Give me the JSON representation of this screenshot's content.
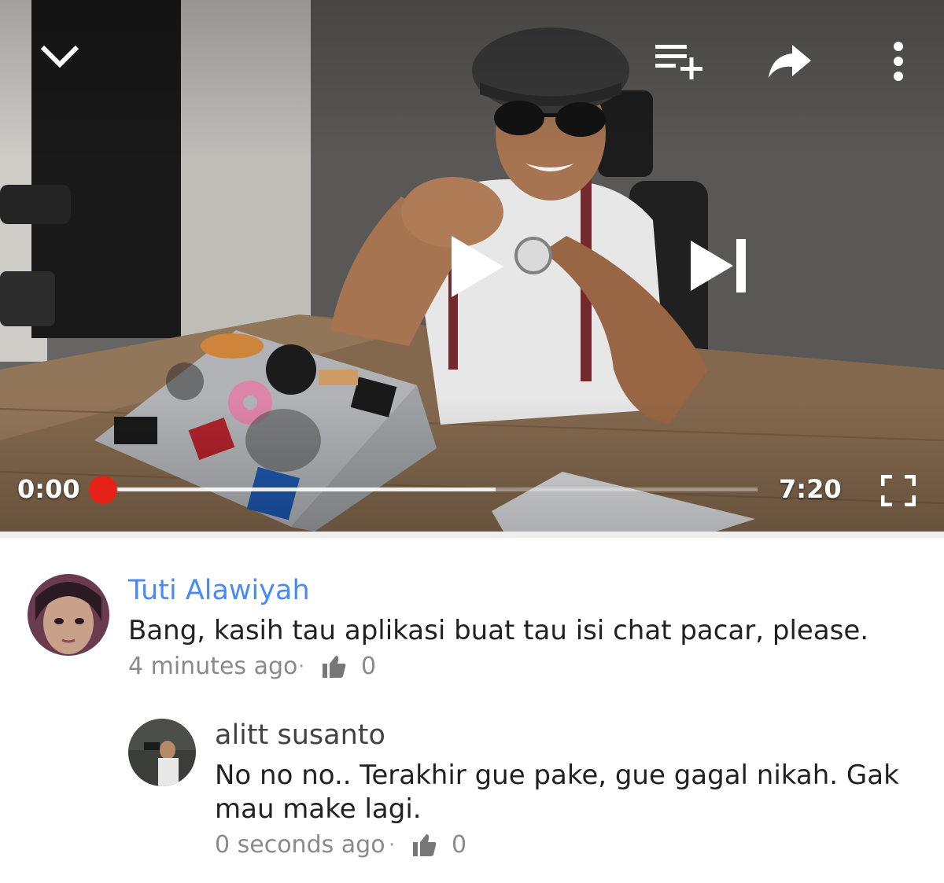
{
  "player": {
    "current_time": "0:00",
    "total_time": "7:20",
    "progress_played": 0.0,
    "progress_buffered": 0.6,
    "icons": {
      "minimize": "chevron-down-icon",
      "add_to_playlist": "playlist-add-icon",
      "share": "share-icon",
      "more": "more-vert-icon",
      "play": "play-icon",
      "next": "skip-next-icon",
      "fullscreen": "fullscreen-icon"
    },
    "accent": "#e62117"
  },
  "comments": [
    {
      "author": "Tuti Alawiyah",
      "author_color": "#4a8af4",
      "text": "Bang, kasih tau aplikasi buat tau isi chat pacar, please.",
      "time": "4 minutes ago",
      "likes": "0"
    },
    {
      "author": "alitt susanto",
      "author_color": "#424242",
      "text": "No no no.. Terakhir gue pake, gue gagal nikah. Gak mau make lagi.",
      "time": "0 seconds ago",
      "likes": "0"
    }
  ],
  "separator": "·"
}
